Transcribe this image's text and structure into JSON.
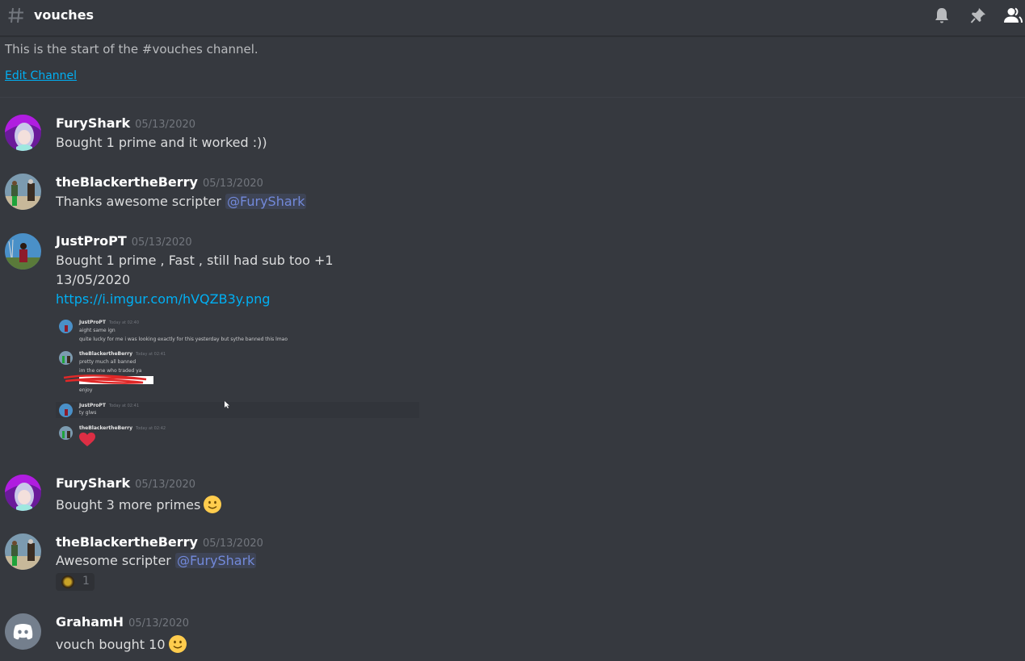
{
  "header": {
    "channel_icon": "hash-icon",
    "channel_name": "vouches",
    "icons": [
      "bell-icon",
      "pin-icon",
      "members-icon"
    ]
  },
  "intro": {
    "text": "This is the start of the #vouches channel.",
    "edit_link": "Edit Channel"
  },
  "colors": {
    "background": "#36393f",
    "link": "#00b0f4",
    "mention": "#7289da",
    "timestamp": "#72767d"
  },
  "messages": [
    {
      "username": "FuryShark",
      "timestamp": "05/13/2020",
      "lines": [
        "Bought 1 prime and it worked :))"
      ]
    },
    {
      "username": "theBlackertheBerry",
      "timestamp": "05/13/2020",
      "text": "Thanks awesome scripter ",
      "mention": "@FuryShark"
    },
    {
      "username": "JustProPT",
      "timestamp": "05/13/2020",
      "lines": [
        "Bought 1 prime , Fast , still had sub too +1",
        "13/05/2020"
      ],
      "link": "https://i.imgur.com/hVQZB3y.png",
      "attachment": {
        "messages": [
          {
            "username": "JustProPT",
            "timestamp": "Today at 02:40",
            "lines": [
              "aight same ign",
              "quite lucky for me i was looking exactly for this yesterday but sythe banned this  lmao"
            ]
          },
          {
            "username": "theBlackertheBerry",
            "timestamp": "Today at 02:41",
            "lines": [
              "pretty much all banned",
              "im the one who traded ya",
              "enjoy"
            ]
          },
          {
            "username": "JustProPT",
            "timestamp": "Today at 02:41",
            "lines": [
              "ty glws"
            ]
          },
          {
            "username": "theBlackertheBerry",
            "timestamp": "Today at 02:42",
            "emoji": "heart-icon"
          }
        ]
      }
    },
    {
      "username": "FuryShark",
      "timestamp": "05/13/2020",
      "text": "Bought 3 more primes",
      "emoji": "slightly-smiling-face-icon"
    },
    {
      "username": "theBlackertheBerry",
      "timestamp": "05/13/2020",
      "text": "Awesome scripter ",
      "mention": "@FuryShark",
      "reaction": {
        "emoji": "custom-emoji-icon",
        "count": "1"
      }
    },
    {
      "username": "GrahamH",
      "timestamp": "05/13/2020",
      "text": "vouch bought 10",
      "emoji": "slightly-smiling-face-icon"
    }
  ]
}
